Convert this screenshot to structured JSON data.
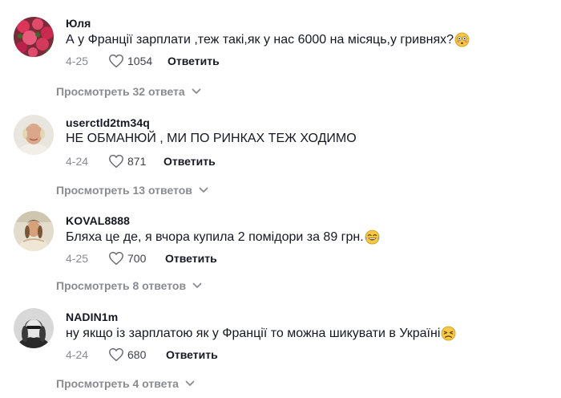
{
  "comments": [
    {
      "username": "Юля",
      "text": "А у Франції зарплати ,теж такі,як у нас 6000 на місяць,у гривнях?",
      "emoji": "flushed-emoji",
      "date": "4-25",
      "likes": "1054",
      "reply_label": "Ответить",
      "replies_label": "Просмотреть 32 ответа",
      "avatar": "roses-avatar"
    },
    {
      "username": "userctld2tm34q",
      "text": "НЕ ОБМАНЮЙ , МИ ПО РИНКАХ ТЕЖ ХОДИМО",
      "emoji": "",
      "date": "4-24",
      "likes": "871",
      "reply_label": "Ответить",
      "replies_label": "Просмотреть 13 ответов",
      "avatar": "woman-avatar"
    },
    {
      "username": "KOVAL8888",
      "text": "Бляха це де, я вчора купила 2 помідори за 89 грн.",
      "emoji": "tears-of-joy-emoji",
      "date": "4-25",
      "likes": "700",
      "reply_label": "Ответить",
      "replies_label": "Просмотреть 8 ответов",
      "avatar": "woman-avatar"
    },
    {
      "username": "NADIN1m",
      "text": "ну якщо із зарплатою як у Франції то можна шикувати в Україні",
      "emoji": "persevering-emoji",
      "date": "4-24",
      "likes": "680",
      "reply_label": "Ответить",
      "replies_label": "Просмотреть 4 ответа",
      "avatar": "woman-bw-avatar"
    }
  ]
}
